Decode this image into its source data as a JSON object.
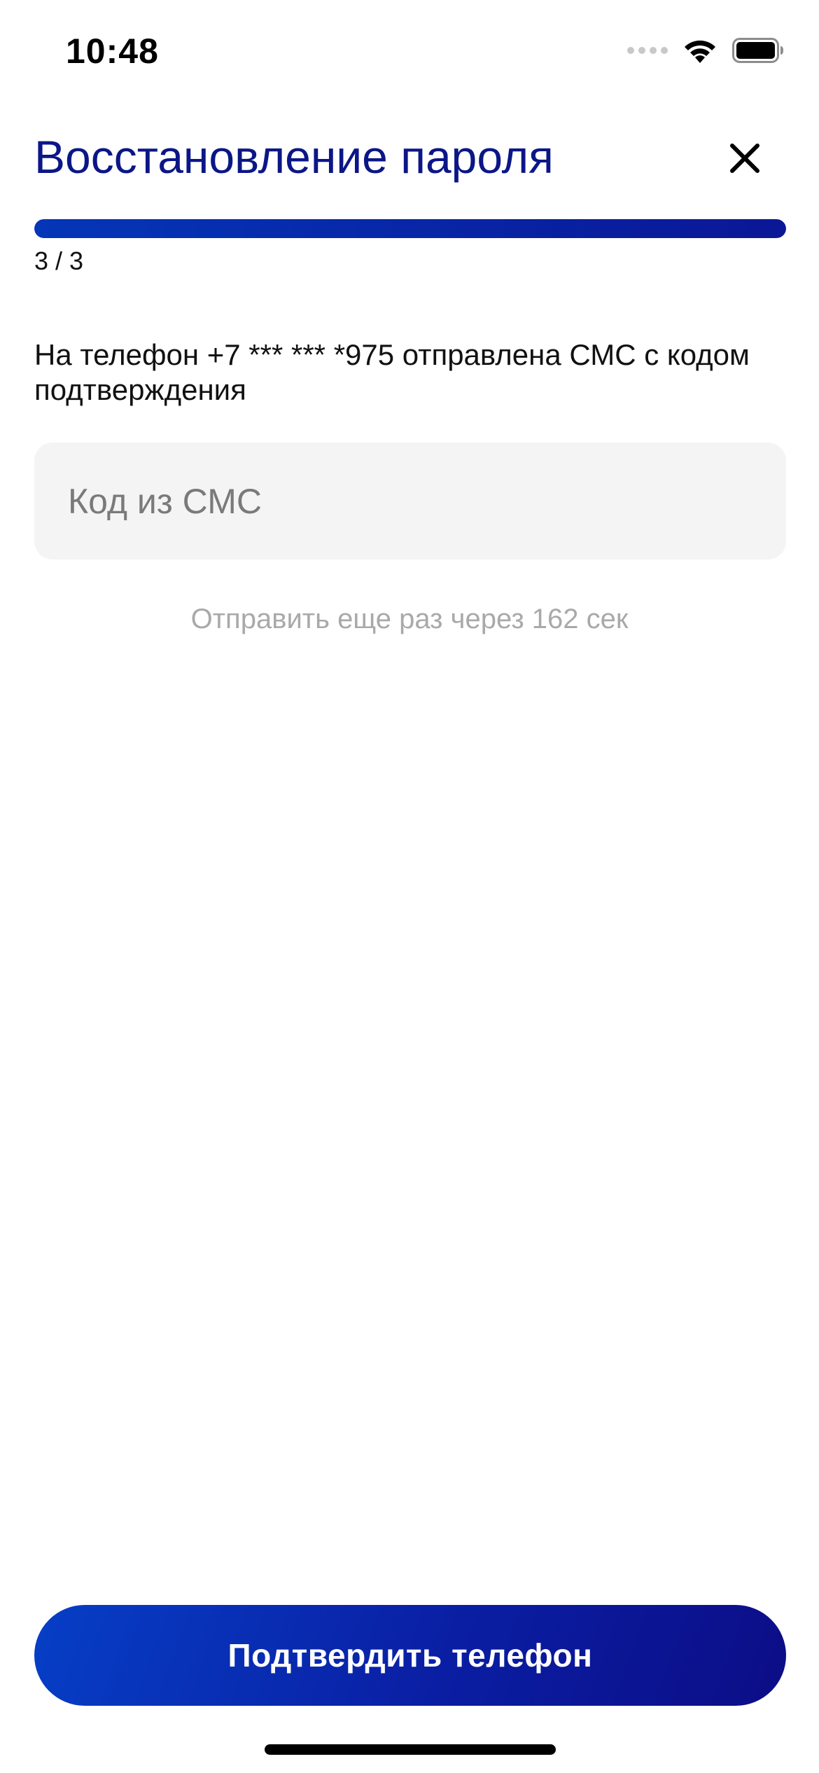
{
  "status_bar": {
    "time": "10:48",
    "icons": [
      "signal-icon",
      "wifi-icon",
      "battery-icon"
    ]
  },
  "header": {
    "title": "Восстановление пароля",
    "close_icon": "close-icon"
  },
  "progress": {
    "step_label": "3 / 3",
    "fraction": 1.0
  },
  "content": {
    "info": "На телефон +7 *** *** *975 отправлена СМС с кодом подтверждения",
    "code_input": {
      "placeholder": "Код из СМС",
      "value": ""
    },
    "resend": "Отправить еще раз через 162 сек"
  },
  "footer": {
    "confirm_label": "Подтвердить телефон"
  },
  "colors": {
    "title": "#0b1687",
    "accent_start": "#063fc6",
    "accent_end": "#0c0d86",
    "input_bg": "#f4f4f4",
    "muted_text": "#a9a9a9"
  }
}
